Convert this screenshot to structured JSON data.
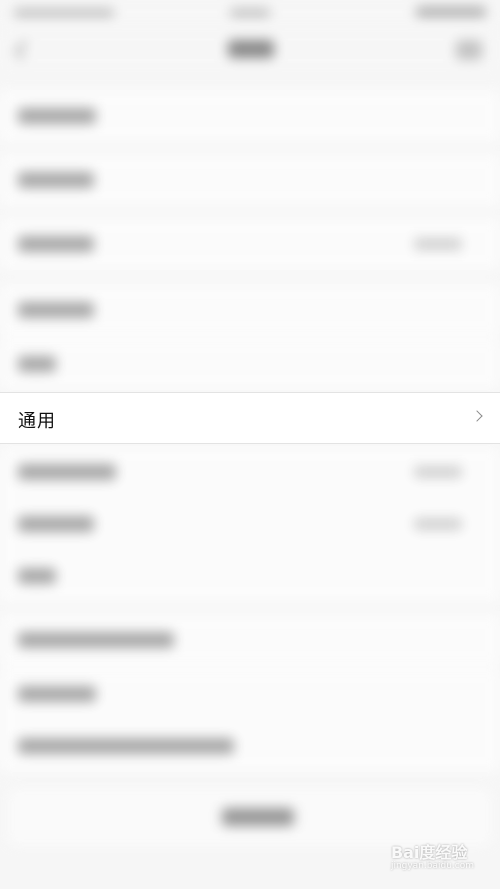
{
  "settings": {
    "general_label": "通用",
    "general_chevron_icon": "chevron-right-icon"
  },
  "watermark": {
    "brand_text": "Bai度经验",
    "domain_text": "jingyan.baidu.com"
  }
}
